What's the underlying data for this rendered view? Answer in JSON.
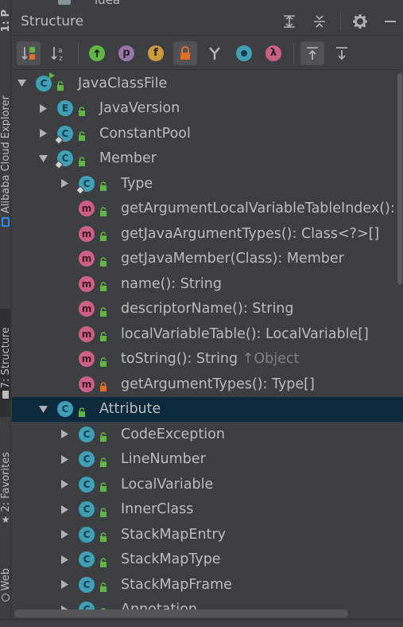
{
  "side_tabs": {
    "project_label": "1: P",
    "alibaba_label": "Alibaba Cloud Explorer",
    "structure_label": "7: Structure",
    "favorites_label": "2: Favorites",
    "web_label": "Web"
  },
  "top_remnant": {
    "label": "idea"
  },
  "panel": {
    "title": "Structure"
  },
  "header_buttons": [
    "expand-all-icon",
    "collapse-all-icon",
    "gear-icon",
    "minimize-icon"
  ],
  "toolbar": {
    "buttons": [
      {
        "name": "sort-by-visibility-button",
        "icon": "sort-visibility-icon",
        "selected": true
      },
      {
        "name": "sort-alphabetically-button",
        "icon": "sort-alpha-icon",
        "selected": false
      },
      {
        "name": "show-inherited-button",
        "icon": "inherited-icon",
        "selected": false
      },
      {
        "name": "show-properties-button",
        "icon": "property-icon",
        "glyph": "p",
        "color": "#9876aa"
      },
      {
        "name": "show-fields-button",
        "icon": "field-icon",
        "glyph": "f",
        "color": "#c89a3b"
      },
      {
        "name": "show-non-public-button",
        "icon": "lock-icon",
        "selected": true
      },
      {
        "name": "show-anonymous-button",
        "icon": "anonymous-icon"
      },
      {
        "name": "show-lambdas-button",
        "icon": "lambda-icon",
        "glyph": "λ",
        "color": "#ce5f84"
      },
      {
        "name": "autoscroll-to-source-button",
        "icon": "autoscroll-to-source-icon",
        "selected": true
      },
      {
        "name": "autoscroll-from-source-button",
        "icon": "autoscroll-from-source-icon"
      }
    ]
  },
  "colors": {
    "background": "#3c3f41",
    "selection": "#0d293e",
    "class_icon": "#3f9fb7",
    "method_icon": "#ce5f84",
    "public_green": "#62b543",
    "private_lock": "#e06c2a",
    "text": "#bbbbbb",
    "inherited_text": "#808080"
  },
  "tree": [
    {
      "label": "JavaClassFile",
      "type": "class",
      "level": 0,
      "arrow": "down",
      "visibility": "public",
      "runnable": true
    },
    {
      "label": "JavaVersion",
      "type": "enum",
      "level": 1,
      "arrow": "right",
      "visibility": "public"
    },
    {
      "label": "ConstantPool",
      "type": "class",
      "level": 1,
      "arrow": "right",
      "visibility": "public",
      "static": true
    },
    {
      "label": "Member",
      "type": "class",
      "level": 1,
      "arrow": "down",
      "visibility": "public",
      "static": true
    },
    {
      "label": "Type",
      "type": "class",
      "level": 2,
      "arrow": "right",
      "visibility": "public",
      "static": true
    },
    {
      "label": "getArgumentLocalVariableTableIndex(): int",
      "type": "method",
      "level": 2,
      "visibility": "public"
    },
    {
      "label": "getJavaArgumentTypes(): Class<?>[]",
      "type": "method",
      "level": 2,
      "visibility": "public"
    },
    {
      "label": "getJavaMember(Class): Member",
      "type": "method",
      "level": 2,
      "visibility": "public"
    },
    {
      "label": "name(): String",
      "type": "method",
      "level": 2,
      "visibility": "public"
    },
    {
      "label": "descriptorName(): String",
      "type": "method",
      "level": 2,
      "visibility": "public"
    },
    {
      "label": "localVariableTable(): LocalVariable[]",
      "type": "method",
      "level": 2,
      "visibility": "public"
    },
    {
      "label": "toString(): String",
      "inherited": "↑Object",
      "type": "method",
      "level": 2,
      "visibility": "public"
    },
    {
      "label": "getArgumentTypes(): Type[]",
      "type": "method",
      "level": 2,
      "visibility": "private"
    },
    {
      "label": "Attribute",
      "type": "class",
      "level": 1,
      "arrow": "down",
      "visibility": "public",
      "selected": true
    },
    {
      "label": "CodeException",
      "type": "class",
      "level": 2,
      "arrow": "right",
      "visibility": "public"
    },
    {
      "label": "LineNumber",
      "type": "class",
      "level": 2,
      "arrow": "right",
      "visibility": "public"
    },
    {
      "label": "LocalVariable",
      "type": "class",
      "level": 2,
      "arrow": "right",
      "visibility": "public"
    },
    {
      "label": "InnerClass",
      "type": "class",
      "level": 2,
      "arrow": "right",
      "visibility": "public"
    },
    {
      "label": "StackMapEntry",
      "type": "class",
      "level": 2,
      "arrow": "right",
      "visibility": "public"
    },
    {
      "label": "StackMapType",
      "type": "class",
      "level": 2,
      "arrow": "right",
      "visibility": "public"
    },
    {
      "label": "StackMapFrame",
      "type": "class",
      "level": 2,
      "arrow": "right",
      "visibility": "public"
    },
    {
      "label": "Annotation",
      "type": "class",
      "level": 2,
      "arrow": "right",
      "visibility": "public"
    }
  ]
}
